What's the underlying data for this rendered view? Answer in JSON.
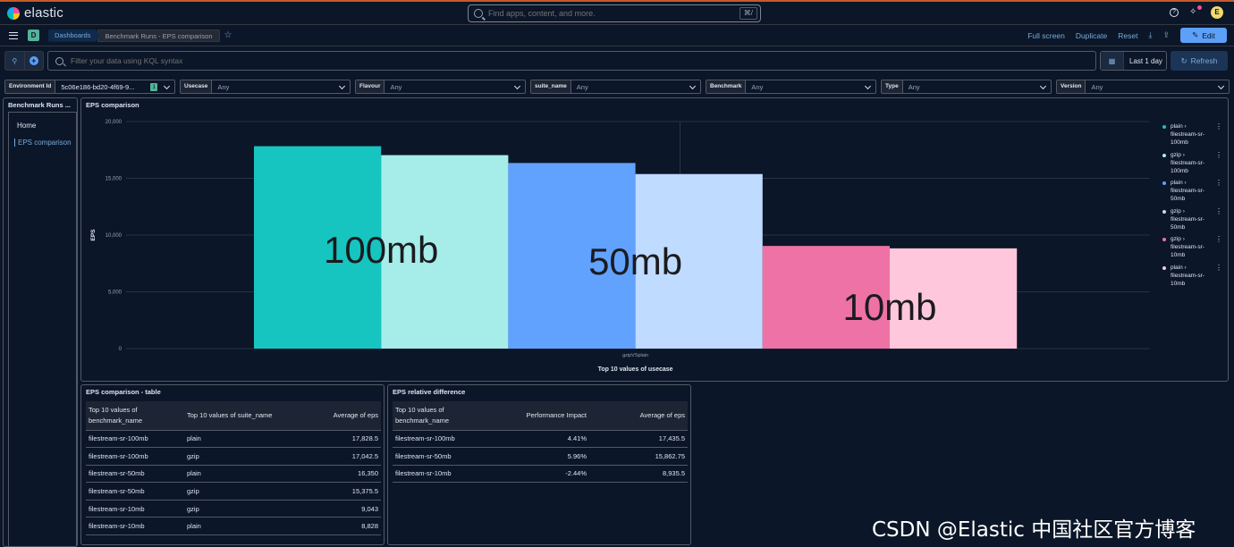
{
  "header": {
    "logo_text": "elastic",
    "search_placeholder": "Find apps, content, and more.",
    "search_shortcut": "⌘/",
    "avatar_initial": "E"
  },
  "breadcrumb": {
    "space_initial": "D",
    "items": [
      "Dashboards",
      "Benchmark Runs - EPS comparison"
    ]
  },
  "toolbar": {
    "full_screen": "Full screen",
    "duplicate": "Duplicate",
    "reset": "Reset",
    "edit": "Edit"
  },
  "query": {
    "placeholder": "Filter your data using KQL syntax",
    "time_range": "Last 1 day",
    "refresh": "Refresh"
  },
  "controls": [
    {
      "label": "Environment Id",
      "value": "5c06e186-bd20-4f69-9...",
      "count": "1"
    },
    {
      "label": "Usecase",
      "value": "Any"
    },
    {
      "label": "Flavour",
      "value": "Any"
    },
    {
      "label": "suite_name",
      "value": "Any"
    },
    {
      "label": "Benchmark",
      "value": "Any"
    },
    {
      "label": "Type",
      "value": "Any"
    },
    {
      "label": "Version",
      "value": "Any"
    }
  ],
  "nav_panel": {
    "title": "Benchmark Runs ...",
    "items": [
      "Home",
      "EPS comparison"
    ]
  },
  "chart_panel": {
    "title": "EPS comparison"
  },
  "chart_data": {
    "type": "bar",
    "xlabel": "Top 10 values of usecase",
    "ylabel": "EPS",
    "categories": [
      "gzipVSplain"
    ],
    "ylim": [
      0,
      20000
    ],
    "yticks": [
      "0",
      "5,000",
      "10,000",
      "15,000",
      "20,000"
    ],
    "grid": true,
    "legend_position": "right",
    "series": [
      {
        "name": "plain › filestream-sr-100mb",
        "values": [
          17828.5
        ],
        "color": "#16c5c0"
      },
      {
        "name": "gzip › filestream-sr-100mb",
        "values": [
          17042.5
        ],
        "color": "#a6edea"
      },
      {
        "name": "plain › filestream-sr-50mb",
        "values": [
          16350
        ],
        "color": "#61a2ff"
      },
      {
        "name": "gzip › filestream-sr-50mb",
        "values": [
          15375.5
        ],
        "color": "#bfdbff"
      },
      {
        "name": "gzip › filestream-sr-10mb",
        "values": [
          9043
        ],
        "color": "#ee72a6"
      },
      {
        "name": "plain › filestream-sr-10mb",
        "values": [
          8828
        ],
        "color": "#ffc7db"
      }
    ],
    "annotations": [
      "100mb",
      "50mb",
      "10mb"
    ]
  },
  "legend": [
    {
      "lines": [
        "plain ›",
        "filestream-sr-",
        "100mb"
      ],
      "color": "#16c5c0"
    },
    {
      "lines": [
        "gzip ›",
        "filestream-sr-",
        "100mb"
      ],
      "color": "#a6edea"
    },
    {
      "lines": [
        "plain ›",
        "filestream-sr-",
        "50mb"
      ],
      "color": "#61a2ff"
    },
    {
      "lines": [
        "gzip ›",
        "filestream-sr-",
        "50mb"
      ],
      "color": "#bfdbff"
    },
    {
      "lines": [
        "gzip ›",
        "filestream-sr-",
        "10mb"
      ],
      "color": "#ee72a6"
    },
    {
      "lines": [
        "plain ›",
        "filestream-sr-",
        "10mb"
      ],
      "color": "#ffc7db"
    }
  ],
  "table1": {
    "title": "EPS comparison - table",
    "headers": [
      "Top 10 values of benchmark_name",
      "Top 10 values of suite_name",
      "Average of eps"
    ],
    "rows": [
      [
        "filestream-sr-100mb",
        "plain",
        "17,828.5"
      ],
      [
        "filestream-sr-100mb",
        "gzip",
        "17,042.5"
      ],
      [
        "filestream-sr-50mb",
        "plain",
        "16,350"
      ],
      [
        "filestream-sr-50mb",
        "gzip",
        "15,375.5"
      ],
      [
        "filestream-sr-10mb",
        "gzip",
        "9,043"
      ],
      [
        "filestream-sr-10mb",
        "plain",
        "8,828"
      ]
    ]
  },
  "table2": {
    "title": "EPS relative difference",
    "headers": [
      "Top 10 values of benchmark_name",
      "Performance Impact",
      "Average of eps"
    ],
    "rows": [
      [
        "filestream-sr-100mb",
        "4.41%",
        "17,435.5"
      ],
      [
        "filestream-sr-50mb",
        "5.96%",
        "15,862.75"
      ],
      [
        "filestream-sr-10mb",
        "-2.44%",
        "8,935.5"
      ]
    ]
  },
  "watermark": "CSDN @Elastic 中国社区官方博客"
}
